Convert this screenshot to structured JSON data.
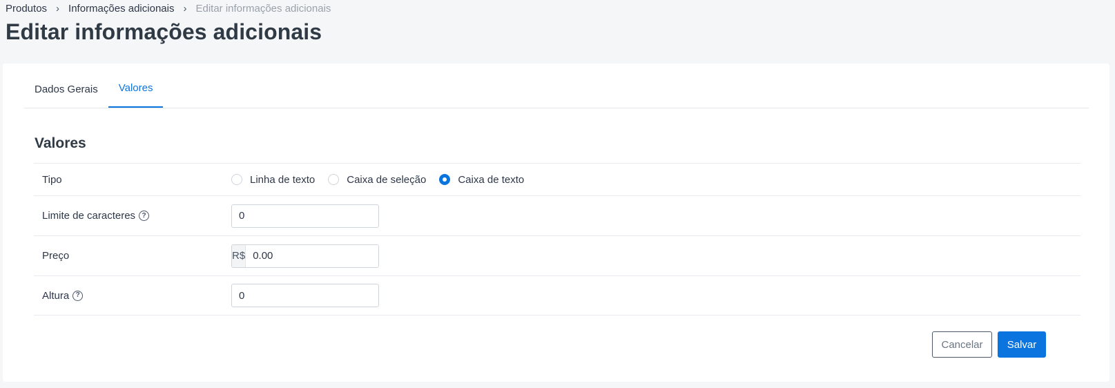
{
  "breadcrumb": {
    "items": [
      "Produtos",
      "Informações adicionais"
    ],
    "current": "Editar informações adicionais",
    "separator": "›"
  },
  "page": {
    "title": "Editar informações adicionais"
  },
  "tabs": [
    {
      "label": "Dados Gerais",
      "active": false
    },
    {
      "label": "Valores",
      "active": true
    }
  ],
  "section": {
    "title": "Valores"
  },
  "form": {
    "tipo": {
      "label": "Tipo",
      "options": [
        "Linha de texto",
        "Caixa de seleção",
        "Caixa de texto"
      ],
      "selected": "Caixa de texto"
    },
    "limite": {
      "label": "Limite de caracteres",
      "value": "0",
      "help_icon": "question-circle-icon"
    },
    "preco": {
      "label": "Preço",
      "currency": "R$",
      "value": "0.00"
    },
    "altura": {
      "label": "Altura",
      "value": "0",
      "help_icon": "question-circle-icon"
    }
  },
  "actions": {
    "cancel_label": "Cancelar",
    "save_label": "Salvar"
  },
  "colors": {
    "primary": "#0b74de",
    "background": "#f5f6f8",
    "card": "#ffffff"
  }
}
